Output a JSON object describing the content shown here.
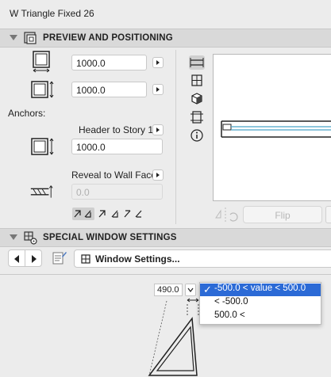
{
  "window": {
    "title": "W Triangle Fixed 26"
  },
  "preview_section": {
    "title": "PREVIEW AND POSITIONING",
    "width_value": "1000.0",
    "height_value": "1000.0",
    "anchors_label": "Anchors:",
    "header_anchor_label": "Header to Story 1",
    "header_value": "1000.0",
    "reveal_label": "Reveal to Wall Face",
    "reveal_value": "0.0",
    "flip_label": "Flip"
  },
  "special_section": {
    "title": "SPECIAL WINDOW SETTINGS",
    "window_settings_label": "Window Settings..."
  },
  "editor": {
    "dimension_value": "490.0",
    "dropdown_options": [
      {
        "label": "-500.0 < value < 500.0",
        "selected": true
      },
      {
        "label": "< -500.0",
        "selected": false
      },
      {
        "label": "500.0 <",
        "selected": false
      }
    ]
  },
  "colors": {
    "accent": "#2b6ad6",
    "section_bar": "#d9d9d9"
  }
}
